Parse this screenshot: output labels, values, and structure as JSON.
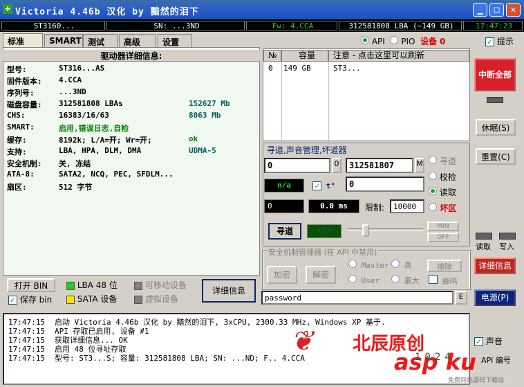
{
  "window": {
    "title": "Victoria 4.46b 汉化 by 黯然的泪下"
  },
  "infobar": {
    "model": "ST3160...",
    "sn": "SN: ...3ND",
    "fw": "Fw: 4.CCA",
    "lba": "312581808 LBA (~149 GB)",
    "time": "17:47:23"
  },
  "tabs": [
    "标准",
    "SMART",
    "测试",
    "高级",
    "设置"
  ],
  "mode": {
    "api": "API",
    "pio": "PIO",
    "device_label": "设备",
    "device_num": "0",
    "hint": "提示"
  },
  "info": {
    "title": "驱动器详细信息:",
    "rows": [
      {
        "k": "型号:",
        "v": "ST316...AS",
        "v2": ""
      },
      {
        "k": "固件版本:",
        "v": "4.CCA",
        "v2": ""
      },
      {
        "k": "序列号:",
        "v": "...3ND",
        "v2": ""
      },
      {
        "k": "磁盘容量:",
        "v": "312581808 LBAs",
        "v2": "152627 Mb"
      },
      {
        "k": "CHS:",
        "v": "16383/16/63",
        "v2": "8063 Mb"
      },
      {
        "k": "SMART:",
        "v": "启用,错误日志,自检",
        "v2": ""
      },
      {
        "k": "缓存:",
        "v": "8192k; L/A=开; Wr=开;",
        "v2": "ok"
      },
      {
        "k": "支持:",
        "v": "LBA, HPA, DLM, DMA",
        "v2": "UDMA-5"
      },
      {
        "k": "安全机制:",
        "v": "关, 冻结",
        "v2": ""
      },
      {
        "k": "ATA-8:",
        "v": "SATA2, NCQ, PEC, SFDLM...",
        "v2": ""
      },
      {
        "k": "扇区:",
        "v": "512 字节",
        "v2": ""
      }
    ]
  },
  "bottom_left": {
    "open_bin": "打开 BIN",
    "save_bin": "保存 bin",
    "lba48": "LBA 48 位",
    "sata": "SATA 设备",
    "removable": "可移动设备",
    "virtual": "虚拟设备",
    "details": "详细信息"
  },
  "list": {
    "col_n": "№",
    "col_cap": "容量",
    "col_note": "注意 - 点击这里可以刷新",
    "row": {
      "n": "0",
      "cap": "149 GB",
      "note": "ST3..."
    }
  },
  "seek": {
    "title": "寻道,声音管理,坏道器",
    "start": "0",
    "zero_btn": "0",
    "end": "312581807",
    "m_btn": "M",
    "na": "n/a",
    "t_label": "t°",
    "temp_val": "0",
    "pos": "0",
    "speed": "0.0 ms",
    "limit_label": "限制:",
    "limit_val": "10000",
    "seek_btn": "寻道",
    "aam": "AAM",
    "min": "MIN",
    "off": "OFF",
    "opt_seek": "寻道",
    "opt_verify": "校检",
    "opt_read": "读取",
    "opt_bad": "坏区"
  },
  "security": {
    "title": "安全机制管理器 (在 API 中禁用)",
    "encrypt": "加密",
    "decrypt": "解密",
    "master": "Master",
    "user": "User",
    "high": "高",
    "max": "最大",
    "erase": "擦除",
    "beep": "蜂鸣"
  },
  "password": {
    "value": "password",
    "btn": "E"
  },
  "right": {
    "stop_all": "中断全部",
    "sleep": "休眠(S)",
    "reset": "重置(C)",
    "read": "读取",
    "write": "写入",
    "details": "详细信息",
    "power": "电源(P)",
    "sound": "声音",
    "api_num": "API 编号"
  },
  "log": [
    {
      "t": "17:47:15",
      "m": "启动 Victoria 4.46b 汉化 by 黯然的泪下, 3xCPU, 2300.33 MHz, Windows XP 基于."
    },
    {
      "t": "17:47:15",
      "m": "API 存取已启用, 设备 #1"
    },
    {
      "t": "17:47:15",
      "m": "获取详细信息...    OK"
    },
    {
      "t": "17:47:15",
      "m": "启用 48 位寻址存取"
    },
    {
      "t": "17:47:15",
      "m": "型号:   ST3...S;    容量: 312581808 LBA; SN: ...ND; F.. 4.CCA"
    }
  ],
  "watermark": {
    "brand": "北辰原创",
    "site": "asp ku",
    "num": "1024",
    "small": "免费网站源码下载站"
  },
  "colors": {
    "title_blue": "#2F60C8",
    "stop_red": "#D8202A",
    "details_red": "#C0281E",
    "power_blue": "#0A2480",
    "lcd_cyan": "#00E0E0"
  }
}
